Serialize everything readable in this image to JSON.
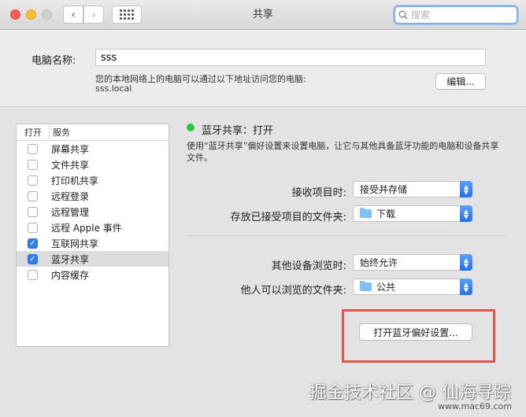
{
  "window": {
    "title": "共享"
  },
  "search": {
    "placeholder": "搜索"
  },
  "computer_name": {
    "label": "电脑名称:",
    "value": "sss",
    "address_text": "您的本地网络上的电脑可以通过以下地址访问您的电脑:",
    "hostname": "sss.local",
    "edit_label": "编辑..."
  },
  "services": {
    "header_on": "打开",
    "header_service": "服务",
    "items": [
      {
        "name": "屏幕共享",
        "checked": false,
        "selected": false
      },
      {
        "name": "文件共享",
        "checked": false,
        "selected": false
      },
      {
        "name": "打印机共享",
        "checked": false,
        "selected": false
      },
      {
        "name": "远程登录",
        "checked": false,
        "selected": false
      },
      {
        "name": "远程管理",
        "checked": false,
        "selected": false
      },
      {
        "name": "远程 Apple 事件",
        "checked": false,
        "selected": false
      },
      {
        "name": "互联网共享",
        "checked": true,
        "selected": false
      },
      {
        "name": "蓝牙共享",
        "checked": true,
        "selected": true
      },
      {
        "name": "内容缓存",
        "checked": false,
        "selected": false
      }
    ]
  },
  "detail": {
    "status": "蓝牙共享：打开",
    "status_color": "#2ac840",
    "description": "使用“蓝牙共享”偏好设置来设置电脑，让它与其他具备蓝牙功能的电脑和设备共享文件。",
    "receive_label": "接收项目时:",
    "receive_value": "接受并存储",
    "save_folder_label": "存放已接受项目的文件夹:",
    "save_folder_value": "下载",
    "browse_label": "其他设备浏览时:",
    "browse_value": "始终允许",
    "browse_folder_label": "他人可以浏览的文件夹:",
    "browse_folder_value": "公共",
    "open_prefs_label": "打开蓝牙偏好设置..."
  },
  "watermark": {
    "text": "掘金技术社区 @ 仙海寻踪",
    "url": "www.mac69.com"
  },
  "colors": {
    "accent": "#2f7df6",
    "highlight_box": "#e0554a"
  }
}
